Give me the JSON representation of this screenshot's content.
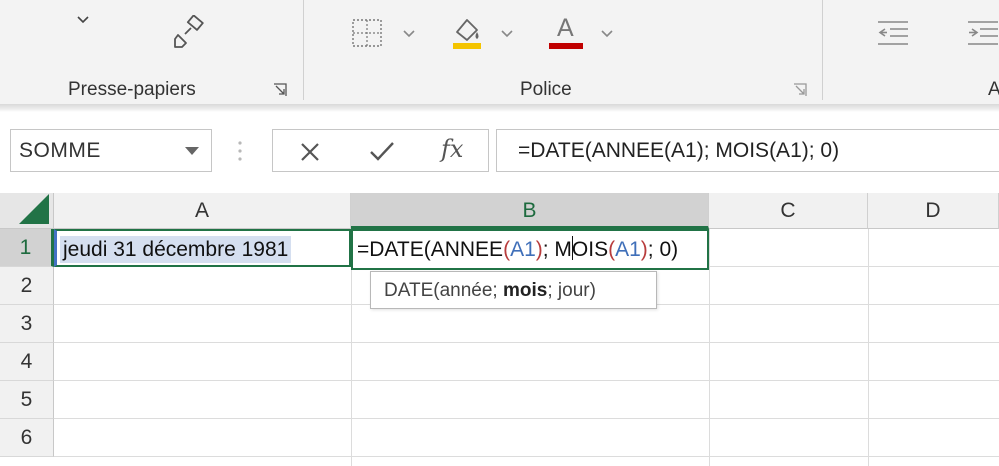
{
  "ribbon": {
    "groups": [
      {
        "label": "Presse-papiers"
      },
      {
        "label": "Police"
      },
      {
        "label": "A"
      }
    ],
    "icons": {
      "dropdown": "chevron-down-icon",
      "format_painter": "format-painter-icon",
      "borders": "borders-icon",
      "fill_color": "fill-color-icon",
      "font_color": "font-color-icon",
      "font_color_letter": "A",
      "decrease_indent": "decrease-indent-icon",
      "increase_indent": "increase-indent-icon",
      "launcher": "dialog-launcher-icon"
    },
    "colors": {
      "fill_bar": "#f4c400",
      "font_bar": "#c00000"
    }
  },
  "formula_bar": {
    "name_box": "SOMME",
    "cancel_icon": "cancel-icon",
    "enter_icon": "checkmark-icon",
    "fx_label": "fx",
    "formula": "=DATE(ANNEE(A1); MOIS(A1); 0)"
  },
  "grid": {
    "columns": [
      "A",
      "B",
      "C",
      "D"
    ],
    "active_column": "B",
    "rows": [
      "1",
      "2",
      "3",
      "4",
      "5",
      "6"
    ],
    "active_row": "1",
    "cells": {
      "A1": "jeudi 31 décembre 1981",
      "B1": {
        "t1": "=DATE(ANNEE",
        "p1": "(",
        "r1": "A1",
        "p2": ")",
        "t2": "; M",
        "t3": "OIS",
        "p3": "(",
        "r2": "A1",
        "p4": ")",
        "t4": "; 0)"
      }
    },
    "tooltip": {
      "pre": "DATE(année; ",
      "bold": "mois",
      "post": "; jour)"
    },
    "colors": {
      "accent": "#217346",
      "ref": "#3f6fb9",
      "paren": "#b83c3c",
      "a1_fill": "#d5dff0"
    }
  }
}
